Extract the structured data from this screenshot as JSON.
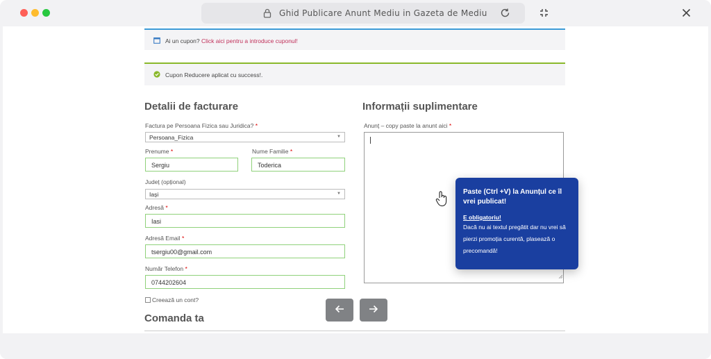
{
  "window": {
    "url_title": "Ghid Publicare Anunt Mediu in Gazeta de Mediu"
  },
  "coupon_notice": {
    "text": "Ai un cupon?",
    "link": "Click aici pentru a introduce cuponul!"
  },
  "success_notice": {
    "text": "Cupon Reducere aplicat cu success!."
  },
  "billing": {
    "title": "Detalii de facturare",
    "type_label": "Factura pe Persoana Fizica sau Juridica?",
    "type_value": "Persoana_Fizica",
    "first_name_label": "Prenume",
    "first_name_value": "Sergiu",
    "last_name_label": "Nume Familie",
    "last_name_value": "Toderica",
    "county_label": "Județ (opțional)",
    "county_value": "Iași",
    "address_label": "Adresă",
    "address_value": "Iasi",
    "email_label": "Adresă Email",
    "email_value": "tsergiu00@gmail.com",
    "phone_label": "Număr Telefon",
    "phone_value": "0744202604",
    "create_account_label": "Creează un cont?",
    "required_mark": "*"
  },
  "additional": {
    "title": "Informații suplimentare",
    "ad_label": "Anunț – copy paste la anunt aici"
  },
  "order": {
    "title": "Comanda ta"
  },
  "tooltip": {
    "heading": "Paste (Ctrl +V) la Anunțul ce îl vrei publicat!",
    "strong": "E obligatoriu!",
    "body": "Dacă nu ai textul pregătit dar nu vrei să pierzi promoția curentă, plasează o precomandă!"
  },
  "icons": {
    "lock": "lock-icon",
    "reload": "reload-icon",
    "expand": "expand-icon",
    "close": "close-icon",
    "calendar": "calendar-icon",
    "check": "check-circle-icon",
    "hand": "hand-pointer-icon",
    "prev": "arrow-left-icon",
    "next": "arrow-right-icon"
  },
  "colors": {
    "tooltip_bg": "#1a3fa0",
    "input_border": "#8fd17a",
    "coupon_bar": "#3b9ad6",
    "success_bar": "#8ab82b",
    "link": "#c0305a"
  }
}
